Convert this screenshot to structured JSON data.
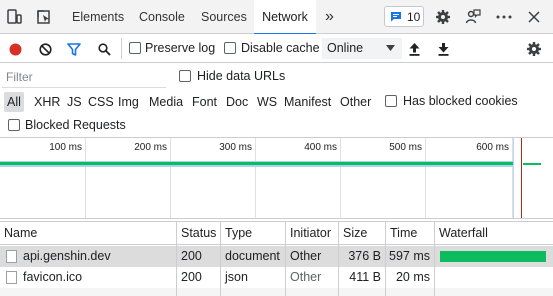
{
  "tabs": [
    {
      "label": "Elements"
    },
    {
      "label": "Console"
    },
    {
      "label": "Sources"
    },
    {
      "label": "Network",
      "active": true
    }
  ],
  "more_tabs_glyph": "»",
  "issues_badge": {
    "count": "10"
  },
  "toolbar": {
    "preserve_log": "Preserve log",
    "disable_cache": "Disable cache",
    "throttling": "Online"
  },
  "filter": {
    "placeholder": "Filter",
    "hide_data_urls": "Hide data URLs",
    "types": [
      "All",
      "XHR",
      "JS",
      "CSS",
      "Img",
      "Media",
      "Font",
      "Doc",
      "WS",
      "Manifest",
      "Other"
    ],
    "has_blocked_cookies": "Has blocked cookies",
    "blocked_requests": "Blocked Requests"
  },
  "timeline": {
    "ticks": [
      "100 ms",
      "200 ms",
      "300 ms",
      "400 ms",
      "500 ms",
      "600 ms"
    ]
  },
  "table": {
    "columns": [
      "Name",
      "Status",
      "Type",
      "Initiator",
      "Size",
      "Time",
      "Waterfall"
    ],
    "rows": [
      {
        "name": "api.genshin.dev",
        "status": "200",
        "type": "document",
        "initiator": "Other",
        "size": "376 B",
        "time": "597 ms"
      },
      {
        "name": "favicon.ico",
        "status": "200",
        "type": "json",
        "initiator": "Other",
        "size": "411 B",
        "time": "20 ms"
      }
    ]
  },
  "colors": {
    "accent": "#1a73e8",
    "record": "#d93025",
    "waterfall_green": "#0dbc5f",
    "selected_row": "#dcdcdc"
  },
  "icons": [
    "device-toolbar-icon",
    "inspect-icon",
    "message-icon",
    "gear-icon",
    "feedback-icon",
    "more-icon",
    "close-icon",
    "record-icon",
    "clear-icon",
    "filter-icon",
    "search-icon",
    "upload-icon",
    "download-icon",
    "network-settings-icon",
    "file-icon"
  ]
}
